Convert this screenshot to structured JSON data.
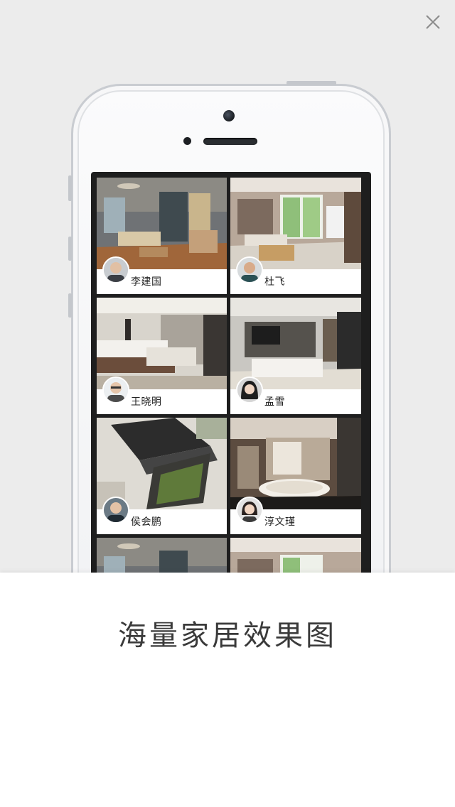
{
  "close_icon": "close-icon",
  "designers": [
    {
      "name": "李建国"
    },
    {
      "name": "杜飞"
    },
    {
      "name": "王晓明"
    },
    {
      "name": "孟雪"
    },
    {
      "name": "侯会鹏"
    },
    {
      "name": "淳文瑾"
    }
  ],
  "caption": "海量家居效果图",
  "colors": {
    "background": "#ececec",
    "panel": "#ffffff",
    "caption_text": "#3a3a3a"
  }
}
